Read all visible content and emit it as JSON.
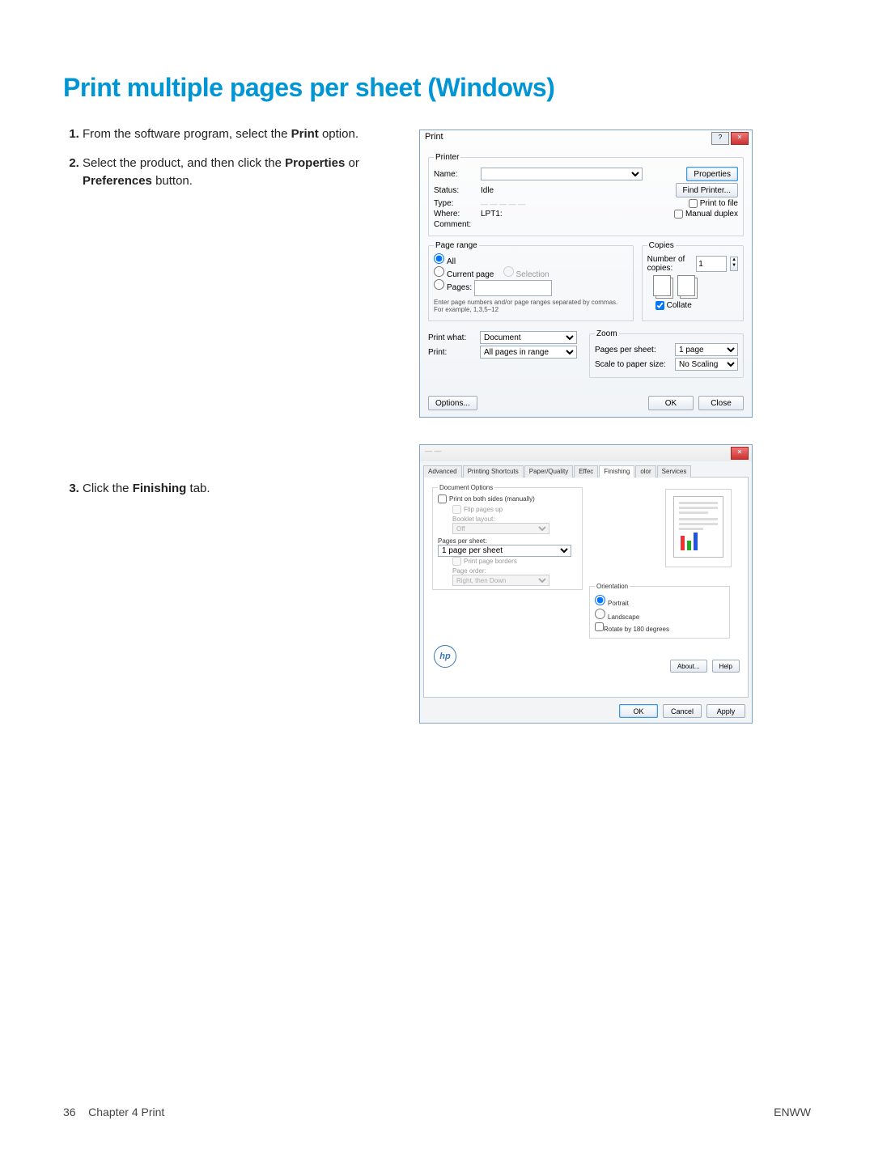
{
  "doc": {
    "title": "Print multiple pages per sheet (Windows)",
    "steps": {
      "s1a": "From the software program, select the ",
      "s1b": "Print",
      "s1c": " option.",
      "s2a": "Select the product, and then click the ",
      "s2b": "Properties",
      "s2c": " or ",
      "s2d": "Preferences",
      "s2e": " button.",
      "s3a": "Click the ",
      "s3b": "Finishing",
      "s3c": " tab."
    },
    "footer": {
      "pageNum": "36",
      "chapter": "Chapter 4   Print",
      "lang": "ENWW"
    }
  },
  "printDlg": {
    "title": "Print",
    "printerGroup": "Printer",
    "name": "Name:",
    "status": "Status:",
    "statusVal": "Idle",
    "type": "Type:",
    "where": "Where:",
    "whereVal": "LPT1:",
    "comment": "Comment:",
    "properties": "Properties",
    "findPrinter": "Find Printer...",
    "printToFile": "Print to file",
    "manualDuplex": "Manual duplex",
    "pageRange": "Page range",
    "all": "All",
    "currentPage": "Current page",
    "selection": "Selection",
    "pages": "Pages:",
    "hint": "Enter page numbers and/or page ranges separated by commas. For example, 1,3,5–12",
    "copies": "Copies",
    "numCopies": "Number of copies:",
    "numCopiesVal": "1",
    "collate": "Collate",
    "printWhat": "Print what:",
    "printWhatVal": "Document",
    "print": "Print:",
    "printVal": "All pages in range",
    "zoom": "Zoom",
    "pps": "Pages per sheet:",
    "ppsVal": "1 page",
    "scale": "Scale to paper size:",
    "scaleVal": "No Scaling",
    "options": "Options...",
    "ok": "OK",
    "close": "Close"
  },
  "propDlg": {
    "tabs": [
      "Advanced",
      "Printing Shortcuts",
      "Paper/Quality",
      "Effec",
      "Finishing",
      "olor",
      "Services"
    ],
    "docOptions": "Document Options",
    "printBoth": "Print on both sides (manually)",
    "flip": "Flip pages up",
    "booklet": "Booklet layout:",
    "bookletVal": "Off",
    "ppsLabel": "Pages per sheet:",
    "ppsSel": "1 page per sheet",
    "border": "Print page borders",
    "order": "Page order:",
    "orderVal": "Right, then Down",
    "orientation": "Orientation",
    "portrait": "Portrait",
    "landscape": "Landscape",
    "rotate": "Rotate by 180 degrees",
    "about": "About...",
    "help": "Help",
    "ok": "OK",
    "cancel": "Cancel",
    "apply": "Apply",
    "hp": "hp"
  }
}
